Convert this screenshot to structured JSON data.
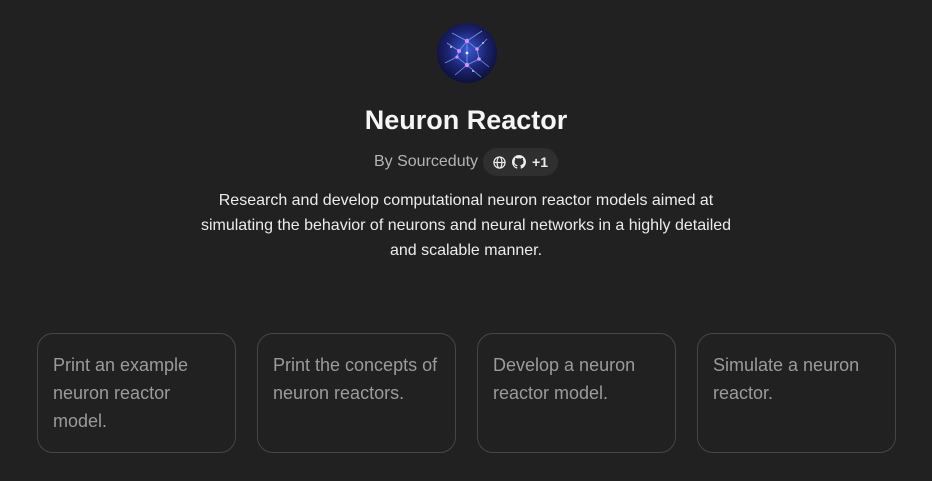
{
  "gpt": {
    "title": "Neuron Reactor",
    "by_label": "By Sourceduty",
    "extra_links": "+1",
    "icons": [
      "avatar-icon",
      "globe-icon",
      "github-icon"
    ],
    "description": "Research and develop computational neuron reactor models aimed at simulating the behavior of neurons and neural networks in a highly detailed and scalable manner."
  },
  "conversation_starters": [
    {
      "label": "Print an example neuron reactor model."
    },
    {
      "label": "Print the concepts of neuron reactors."
    },
    {
      "label": "Develop a neuron reactor model."
    },
    {
      "label": "Simulate a neuron reactor."
    }
  ],
  "colors": {
    "background": "#212121",
    "card_border": "#464646",
    "pill_background": "#2f2f2f",
    "muted_text": "#9b9b9b"
  }
}
